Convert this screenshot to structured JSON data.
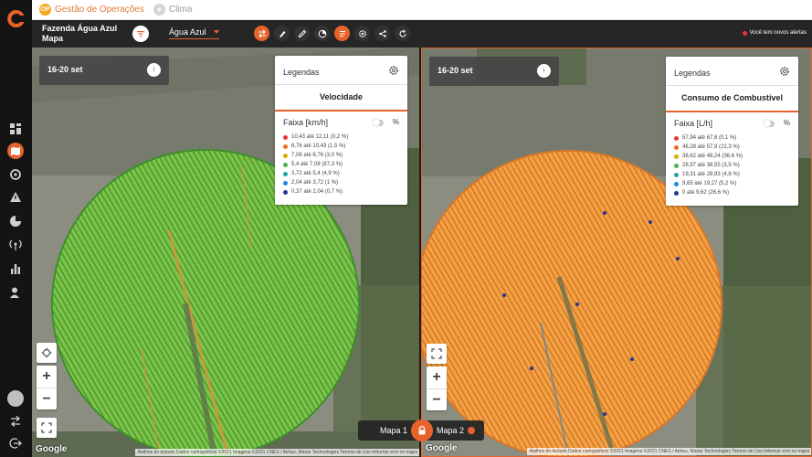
{
  "topbar": {
    "tab_ops": "Gestão de Operações",
    "tab_ops_badge": "OP",
    "tab_climate": "Clima"
  },
  "header": {
    "farm_title": "Fazenda Água Azul",
    "farm_subtitle": "Mapa",
    "farm_select": "Água Azul",
    "alerts": "Você tem novos alertas"
  },
  "map1": {
    "date": "16-20 set",
    "info": "i",
    "legend": {
      "title": "Legendas",
      "variable": "Velocidade",
      "unit": "Faixa [km/h]",
      "pct": "%",
      "items": [
        {
          "label": "10,43 até 12,11 (0,2 %)",
          "color": "#e53935"
        },
        {
          "label": "8,76 até 10,43 (1,5 %)",
          "color": "#f26b1d"
        },
        {
          "label": "7,08 até 8,76 (3,0 %)",
          "color": "#d4b106"
        },
        {
          "label": "5,4 até 7,08 (87,3 %)",
          "color": "#4caf50"
        },
        {
          "label": "3,72 até 5,4 (4,9 %)",
          "color": "#26a69a"
        },
        {
          "label": "2,04 até 3,72 (1 %)",
          "color": "#1e88e5"
        },
        {
          "label": "0,37 até 2,04 (0,7 %)",
          "color": "#283593"
        }
      ]
    },
    "google": "Google",
    "attribution": "Atalhos do teclado  Dados cartográficos ©2021 Imagens ©2021 CNES / Airbus, Maxar Technologies  Termos de Uso  Informar erro no mapa",
    "field_color": "#6fbf3a"
  },
  "map2": {
    "date": "16-20 set",
    "info": "i",
    "legend": {
      "title": "Legendas",
      "variable": "Consumo de Combustível",
      "unit": "Faixa [L/h]",
      "pct": "%",
      "items": [
        {
          "label": "57,94 até 67,6 (0,1 %)",
          "color": "#e53935"
        },
        {
          "label": "48,28 até 57,9 (22,3 %)",
          "color": "#f26b1d"
        },
        {
          "label": "38,62 até 48,24 (36,6 %)",
          "color": "#d4b106"
        },
        {
          "label": "28,97 até 38,55 (3,5 %)",
          "color": "#4caf50"
        },
        {
          "label": "19,31 até 28,93 (4,8 %)",
          "color": "#26a69a"
        },
        {
          "label": "9,65 até 19,27 (5,2 %)",
          "color": "#1e88e5"
        },
        {
          "label": "0 até 9,62 (26,6 %)",
          "color": "#283593"
        }
      ]
    },
    "google": "Google",
    "attribution": "Atalhos do teclado  Dados cartográficos ©2021 Imagens ©2021 CNES / Airbus, Maxar Technologies  Termos de Uso  Informar erro no mapa",
    "field_color": "#f0a040"
  },
  "mapswitch": {
    "map1": "Mapa 1",
    "map2": "Mapa 2"
  }
}
